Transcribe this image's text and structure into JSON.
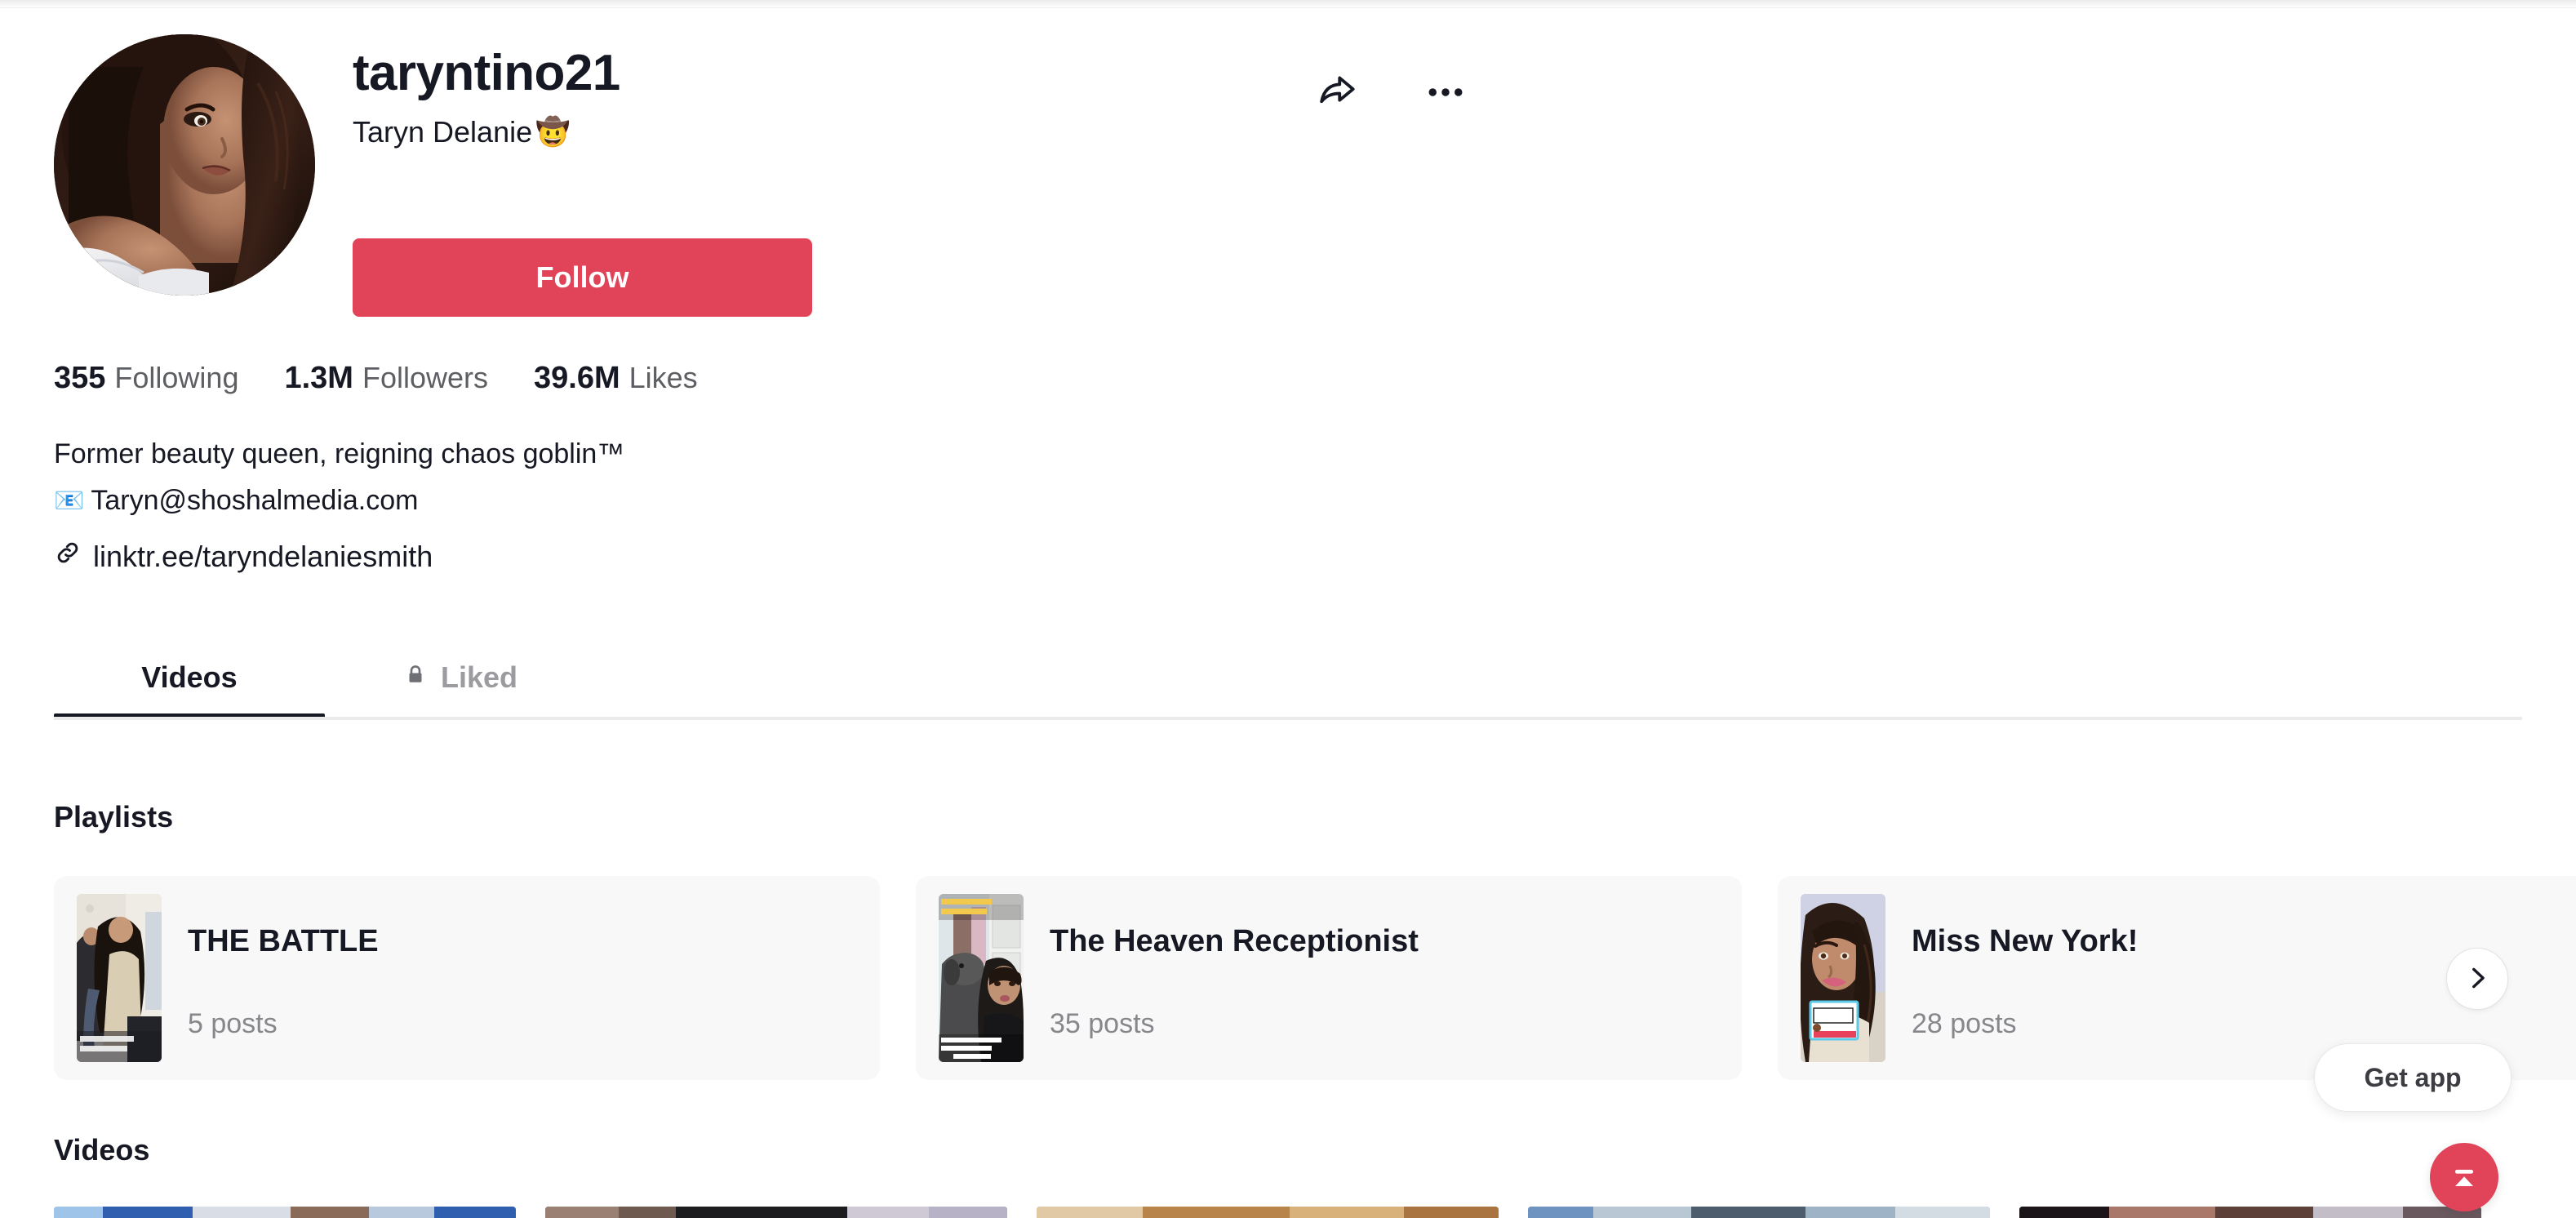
{
  "profile": {
    "username": "taryntino21",
    "display_name": "Taryn Delanie",
    "display_name_emoji": "🤠",
    "avatar_alt": "profile-photo",
    "follow_label": "Follow",
    "share_icon": "share-arrow-icon",
    "more_icon": "three-dots-icon"
  },
  "stats": [
    {
      "name": "following",
      "value": "355",
      "label": "Following"
    },
    {
      "name": "followers",
      "value": "1.3M",
      "label": "Followers"
    },
    {
      "name": "likes",
      "value": "39.6M",
      "label": "Likes"
    }
  ],
  "bio": {
    "line1": "Former beauty queen, reigning chaos goblin™",
    "email_emoji": "📧",
    "email": "Taryn@shoshalmedia.com",
    "link_icon": "chain-link-icon",
    "link": "linktr.ee/taryndelaniesmith"
  },
  "tabs": [
    {
      "name": "videos",
      "label": "Videos",
      "active": true,
      "locked": false
    },
    {
      "name": "liked",
      "label": "Liked",
      "active": false,
      "locked": true,
      "icon": "lock-icon"
    }
  ],
  "sections": {
    "playlists_title": "Playlists",
    "videos_title": "Videos"
  },
  "playlists": [
    {
      "name": "THE BATTLE",
      "posts": "5 posts",
      "thumb": "the-battle-thumb"
    },
    {
      "name": "The Heaven Receptionist",
      "posts": "35 posts",
      "thumb": "heaven-receptionist-thumb"
    },
    {
      "name": "Miss New York!",
      "posts": "28 posts",
      "thumb": "miss-new-york-thumb"
    }
  ],
  "carousel": {
    "next_icon": "chevron-right-icon"
  },
  "videos": [
    {
      "name": "video-1"
    },
    {
      "name": "video-2"
    },
    {
      "name": "video-3"
    },
    {
      "name": "video-4"
    },
    {
      "name": "video-5"
    }
  ],
  "floating": {
    "get_app_label": "Get app",
    "fab_icon": "upload-arrow-icon"
  },
  "colors": {
    "accent": "#e14359",
    "text_primary": "#161823",
    "text_secondary": "#86878b",
    "card_bg": "#f8f8f8",
    "divider": "#ebebec"
  }
}
